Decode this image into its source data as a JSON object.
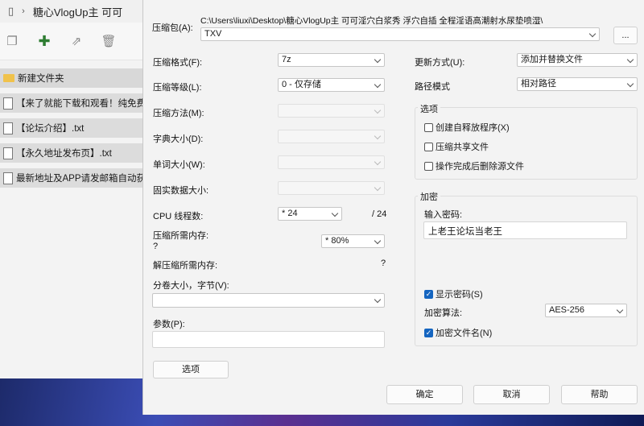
{
  "explorer": {
    "title": "糖心VlogUp主 可可",
    "files": [
      {
        "name": "新建文件夹",
        "type": "folder"
      },
      {
        "name": "【来了就能下载和观看！纯免费",
        "type": "file"
      },
      {
        "name": "【论坛介绍】.txt",
        "type": "file"
      },
      {
        "name": "【永久地址发布页】.txt",
        "type": "file"
      },
      {
        "name": "最新地址及APP请发邮箱自动获",
        "type": "file"
      }
    ]
  },
  "dialog": {
    "archive_label": "压缩包(A):",
    "archive_path": "C:\\Users\\liuxi\\Desktop\\糖心VlogUp主 可可淫穴白浆秀 浮穴自插 全程淫语高潮射水尿垫喷湿\\",
    "archive_name": "TXV",
    "browse_label": "...",
    "left": {
      "format_label": "压缩格式(F):",
      "format_value": "7z",
      "level_label": "压缩等级(L):",
      "level_value": "0 - 仅存储",
      "method_label": "压缩方法(M):",
      "dict_label": "字典大小(D):",
      "word_label": "单词大小(W):",
      "solid_label": "固实数据大小:",
      "cpu_label": "CPU 线程数:",
      "cpu_value": "* 24",
      "cpu_total": "/ 24",
      "mem_label": "压缩所需内存:",
      "mem_q": "?",
      "mem_value": "* 80%",
      "decomp_label": "解压缩所需内存:",
      "decomp_q": "?",
      "volume_label": "分卷大小，字节(V):",
      "params_label": "参数(P):",
      "options_button": "选项"
    },
    "right": {
      "update_label": "更新方式(U):",
      "update_value": "添加并替换文件",
      "path_label": "路径模式",
      "path_value": "相对路径",
      "options_title": "选项",
      "options": [
        {
          "label": "创建自释放程序(X)",
          "checked": false
        },
        {
          "label": "压缩共享文件",
          "checked": false
        },
        {
          "label": "操作完成后删除源文件",
          "checked": false
        }
      ],
      "encrypt_title": "加密",
      "password_label": "输入密码:",
      "password_value": "上老王论坛当老王",
      "show_password": {
        "label": "显示密码(S)",
        "checked": true
      },
      "algo_label": "加密算法:",
      "algo_value": "AES-256",
      "encrypt_names": {
        "label": "加密文件名(N)",
        "checked": true
      }
    },
    "buttons": {
      "ok": "确定",
      "cancel": "取消",
      "help": "帮助"
    }
  },
  "colors": {
    "accent": "#1565c0",
    "folder": "#f0c24b"
  }
}
